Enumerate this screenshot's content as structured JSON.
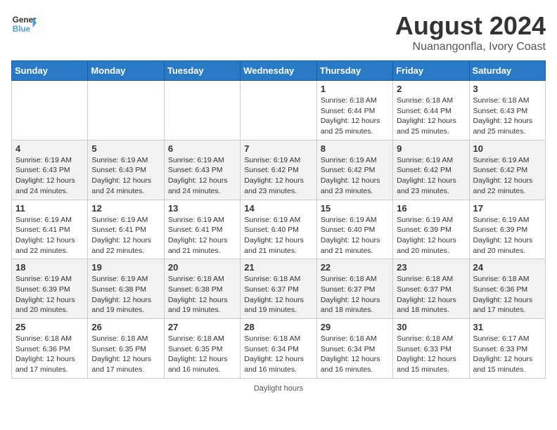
{
  "header": {
    "logo_line1": "General",
    "logo_line2": "Blue",
    "main_title": "August 2024",
    "subtitle": "Nuanangonfla, Ivory Coast"
  },
  "days_of_week": [
    "Sunday",
    "Monday",
    "Tuesday",
    "Wednesday",
    "Thursday",
    "Friday",
    "Saturday"
  ],
  "weeks": [
    [
      {
        "day": "",
        "info": ""
      },
      {
        "day": "",
        "info": ""
      },
      {
        "day": "",
        "info": ""
      },
      {
        "day": "",
        "info": ""
      },
      {
        "day": "1",
        "info": "Sunrise: 6:18 AM\nSunset: 6:44 PM\nDaylight: 12 hours\nand 25 minutes."
      },
      {
        "day": "2",
        "info": "Sunrise: 6:18 AM\nSunset: 6:44 PM\nDaylight: 12 hours\nand 25 minutes."
      },
      {
        "day": "3",
        "info": "Sunrise: 6:18 AM\nSunset: 6:43 PM\nDaylight: 12 hours\nand 25 minutes."
      }
    ],
    [
      {
        "day": "4",
        "info": "Sunrise: 6:19 AM\nSunset: 6:43 PM\nDaylight: 12 hours\nand 24 minutes."
      },
      {
        "day": "5",
        "info": "Sunrise: 6:19 AM\nSunset: 6:43 PM\nDaylight: 12 hours\nand 24 minutes."
      },
      {
        "day": "6",
        "info": "Sunrise: 6:19 AM\nSunset: 6:43 PM\nDaylight: 12 hours\nand 24 minutes."
      },
      {
        "day": "7",
        "info": "Sunrise: 6:19 AM\nSunset: 6:42 PM\nDaylight: 12 hours\nand 23 minutes."
      },
      {
        "day": "8",
        "info": "Sunrise: 6:19 AM\nSunset: 6:42 PM\nDaylight: 12 hours\nand 23 minutes."
      },
      {
        "day": "9",
        "info": "Sunrise: 6:19 AM\nSunset: 6:42 PM\nDaylight: 12 hours\nand 23 minutes."
      },
      {
        "day": "10",
        "info": "Sunrise: 6:19 AM\nSunset: 6:42 PM\nDaylight: 12 hours\nand 22 minutes."
      }
    ],
    [
      {
        "day": "11",
        "info": "Sunrise: 6:19 AM\nSunset: 6:41 PM\nDaylight: 12 hours\nand 22 minutes."
      },
      {
        "day": "12",
        "info": "Sunrise: 6:19 AM\nSunset: 6:41 PM\nDaylight: 12 hours\nand 22 minutes."
      },
      {
        "day": "13",
        "info": "Sunrise: 6:19 AM\nSunset: 6:41 PM\nDaylight: 12 hours\nand 21 minutes."
      },
      {
        "day": "14",
        "info": "Sunrise: 6:19 AM\nSunset: 6:40 PM\nDaylight: 12 hours\nand 21 minutes."
      },
      {
        "day": "15",
        "info": "Sunrise: 6:19 AM\nSunset: 6:40 PM\nDaylight: 12 hours\nand 21 minutes."
      },
      {
        "day": "16",
        "info": "Sunrise: 6:19 AM\nSunset: 6:39 PM\nDaylight: 12 hours\nand 20 minutes."
      },
      {
        "day": "17",
        "info": "Sunrise: 6:19 AM\nSunset: 6:39 PM\nDaylight: 12 hours\nand 20 minutes."
      }
    ],
    [
      {
        "day": "18",
        "info": "Sunrise: 6:19 AM\nSunset: 6:39 PM\nDaylight: 12 hours\nand 20 minutes."
      },
      {
        "day": "19",
        "info": "Sunrise: 6:19 AM\nSunset: 6:38 PM\nDaylight: 12 hours\nand 19 minutes."
      },
      {
        "day": "20",
        "info": "Sunrise: 6:18 AM\nSunset: 6:38 PM\nDaylight: 12 hours\nand 19 minutes."
      },
      {
        "day": "21",
        "info": "Sunrise: 6:18 AM\nSunset: 6:37 PM\nDaylight: 12 hours\nand 19 minutes."
      },
      {
        "day": "22",
        "info": "Sunrise: 6:18 AM\nSunset: 6:37 PM\nDaylight: 12 hours\nand 18 minutes."
      },
      {
        "day": "23",
        "info": "Sunrise: 6:18 AM\nSunset: 6:37 PM\nDaylight: 12 hours\nand 18 minutes."
      },
      {
        "day": "24",
        "info": "Sunrise: 6:18 AM\nSunset: 6:36 PM\nDaylight: 12 hours\nand 17 minutes."
      }
    ],
    [
      {
        "day": "25",
        "info": "Sunrise: 6:18 AM\nSunset: 6:36 PM\nDaylight: 12 hours\nand 17 minutes."
      },
      {
        "day": "26",
        "info": "Sunrise: 6:18 AM\nSunset: 6:35 PM\nDaylight: 12 hours\nand 17 minutes."
      },
      {
        "day": "27",
        "info": "Sunrise: 6:18 AM\nSunset: 6:35 PM\nDaylight: 12 hours\nand 16 minutes."
      },
      {
        "day": "28",
        "info": "Sunrise: 6:18 AM\nSunset: 6:34 PM\nDaylight: 12 hours\nand 16 minutes."
      },
      {
        "day": "29",
        "info": "Sunrise: 6:18 AM\nSunset: 6:34 PM\nDaylight: 12 hours\nand 16 minutes."
      },
      {
        "day": "30",
        "info": "Sunrise: 6:18 AM\nSunset: 6:33 PM\nDaylight: 12 hours\nand 15 minutes."
      },
      {
        "day": "31",
        "info": "Sunrise: 6:17 AM\nSunset: 6:33 PM\nDaylight: 12 hours\nand 15 minutes."
      }
    ]
  ],
  "footer": "Daylight hours"
}
